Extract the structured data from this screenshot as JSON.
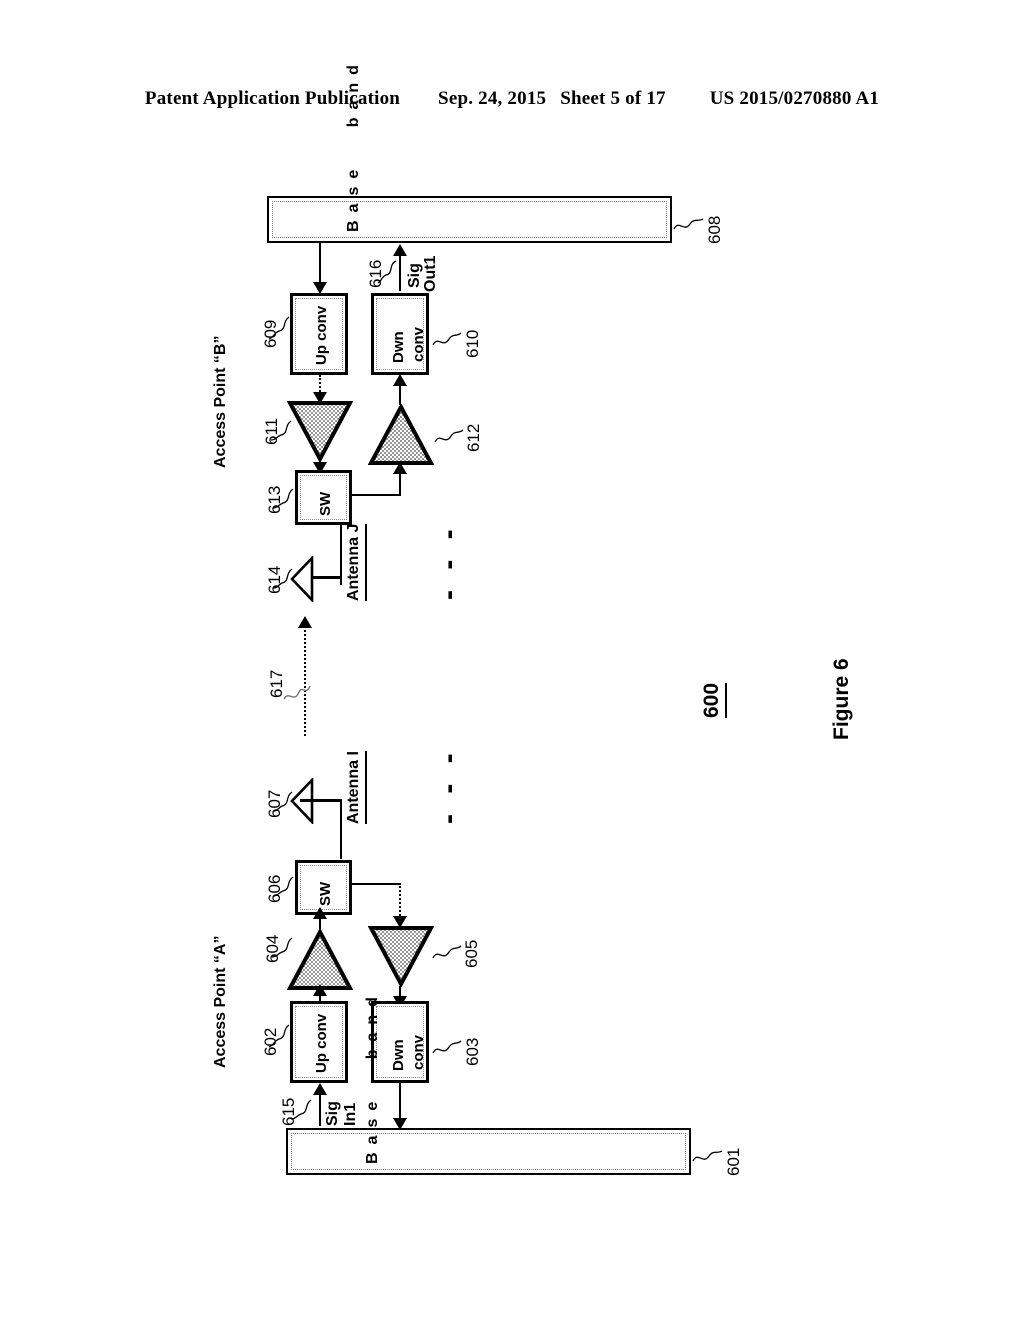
{
  "header": {
    "left": "Patent Application Publication",
    "date": "Sep. 24, 2015",
    "sheet": "Sheet 5 of 17",
    "docnum": "US 2015/0270880 A1"
  },
  "figure": {
    "caption": "Figure 6",
    "number": "600"
  },
  "access_point_b": {
    "title": "Access Point  “B”",
    "baseband": {
      "ref": "608",
      "label": "Base band"
    },
    "up_conv": {
      "ref": "609",
      "label": "Up conv"
    },
    "dwn_conv": {
      "ref": "610",
      "label": "Dwn conv",
      "line1": "Dwn",
      "line2": "conv"
    },
    "pa": {
      "ref": "611"
    },
    "lna": {
      "ref": "612"
    },
    "switch": {
      "ref": "613",
      "label": "SW"
    },
    "antenna": {
      "ref": "614",
      "label": "Antenna J"
    },
    "signal_out": {
      "ref": "616",
      "line1": "Sig",
      "line2": "Out1"
    },
    "continuation_dashes": "- - -"
  },
  "access_point_a": {
    "title": "Access Point  “A”",
    "baseband": {
      "ref": "601",
      "label": "Base band"
    },
    "up_conv": {
      "ref": "602",
      "label": "Up conv"
    },
    "dwn_conv": {
      "ref": "603",
      "label": "Dwn conv",
      "line1": "Dwn",
      "line2": "conv"
    },
    "pa": {
      "ref": "604"
    },
    "lna": {
      "ref": "605"
    },
    "switch": {
      "ref": "606",
      "label": "SW"
    },
    "antenna": {
      "ref": "607",
      "label": "Antenna I"
    },
    "signal_in": {
      "ref": "615",
      "line1": "Sig",
      "line2": "In1"
    },
    "continuation_dashes": "- - -"
  },
  "wireless_link": {
    "ref": "617"
  },
  "colors": {
    "line": "#000000",
    "hatch": "#b4b4b4",
    "background": "#ffffff"
  }
}
